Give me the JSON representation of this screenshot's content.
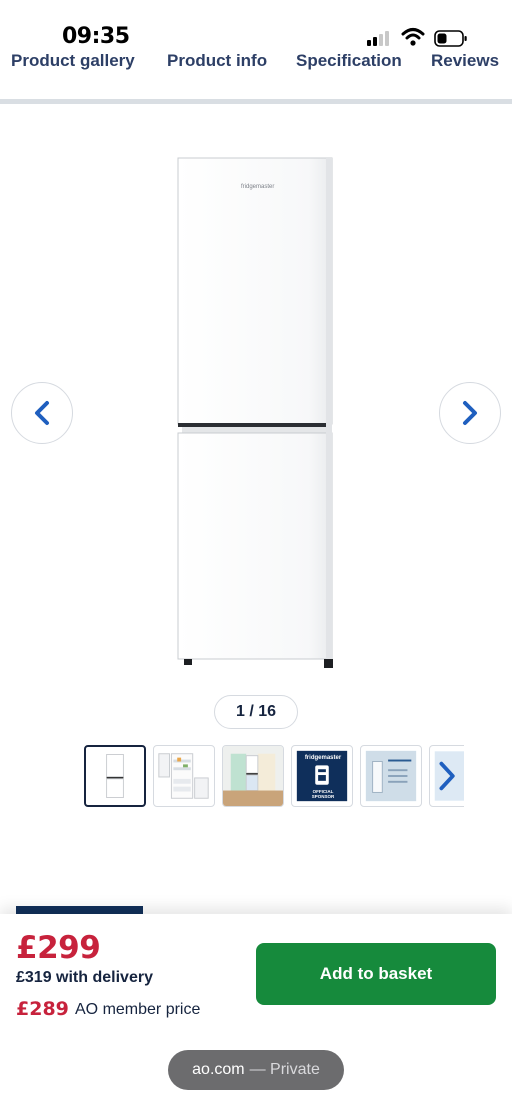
{
  "status_bar": {
    "time": "09:35",
    "signal_icon": "cellular-signal-icon",
    "wifi_icon": "wifi-icon",
    "battery_icon": "battery-low-icon"
  },
  "tabs": [
    {
      "label": "Product gallery"
    },
    {
      "label": "Product info"
    },
    {
      "label": "Specification"
    },
    {
      "label": "Reviews"
    }
  ],
  "gallery": {
    "counter": "1 / 16",
    "current_index": 1,
    "total_images": 16,
    "prev_icon": "chevron-left-icon",
    "next_icon": "chevron-right-icon",
    "product_brand_text": "fridgemaster",
    "thumbnails": [
      {
        "name": "thumbnail-fridge-front",
        "active": true
      },
      {
        "name": "thumbnail-fridge-open",
        "active": false
      },
      {
        "name": "thumbnail-fridge-kitchen",
        "active": false
      },
      {
        "name": "thumbnail-official-sponsor",
        "active": false,
        "brand": "fridgemaster",
        "caption": "OFFICIAL SPONSOR"
      },
      {
        "name": "thumbnail-fridge-feature",
        "active": false
      },
      {
        "name": "thumbnail-partial",
        "active": false
      }
    ]
  },
  "purchase": {
    "price": "£299",
    "delivery_price": "£319 with delivery",
    "member_price": "£289",
    "member_label": "AO member price",
    "add_to_basket": "Add to basket"
  },
  "browser": {
    "domain": "ao.com",
    "mode": "— Private"
  },
  "colors": {
    "accent_blue": "#1f5fbf",
    "navy": "#16243f",
    "price_red": "#c7223c",
    "basket_green": "#168a3c"
  }
}
